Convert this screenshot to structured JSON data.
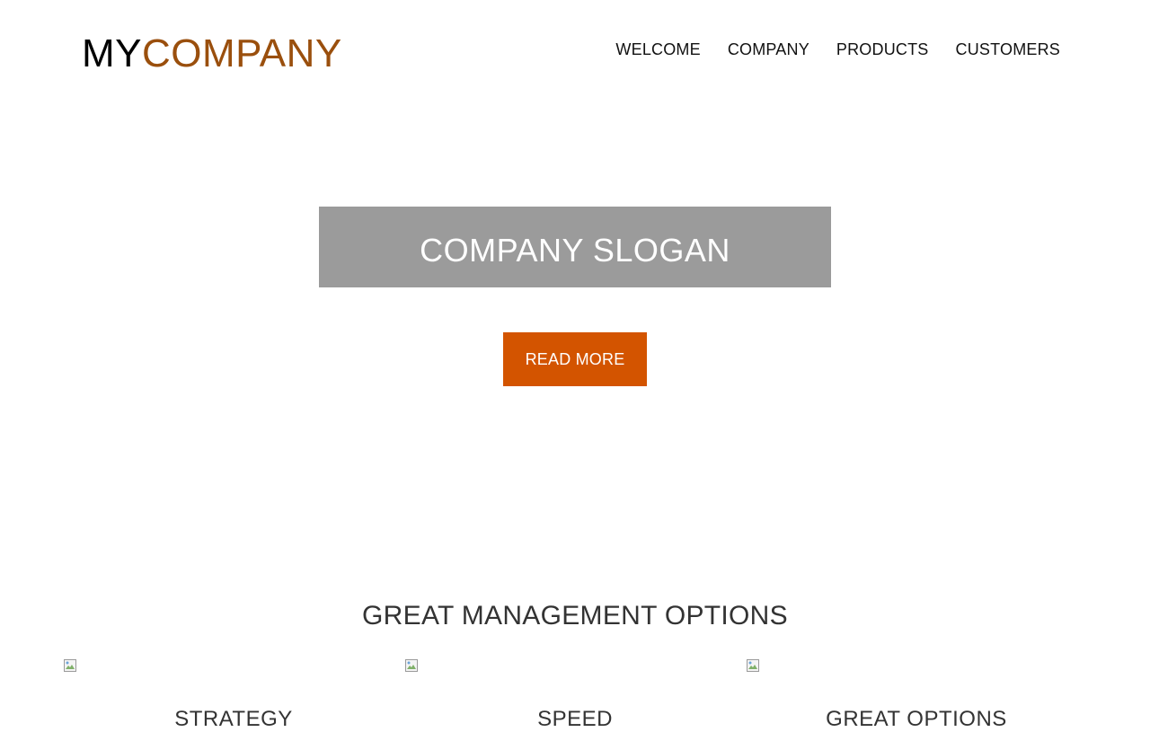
{
  "header": {
    "logo": {
      "my": "MY",
      "company": "COMPANY"
    },
    "nav": [
      "WELCOME",
      "COMPANY",
      "PRODUCTS",
      "CUSTOMERS"
    ]
  },
  "hero": {
    "slogan": "COMPANY SLOGAN",
    "button_label": "READ MORE"
  },
  "features": {
    "title": "GREAT MANAGEMENT OPTIONS",
    "items": [
      {
        "title": "STRATEGY",
        "image": "broken-image-icon"
      },
      {
        "title": "SPEED",
        "image": "broken-image-icon"
      },
      {
        "title": "GREAT OPTIONS",
        "image": "broken-image-icon"
      }
    ]
  },
  "colors": {
    "brand": "#9a4f0d",
    "accent": "#d35400",
    "slogan_bg": "#9b9b9b"
  }
}
